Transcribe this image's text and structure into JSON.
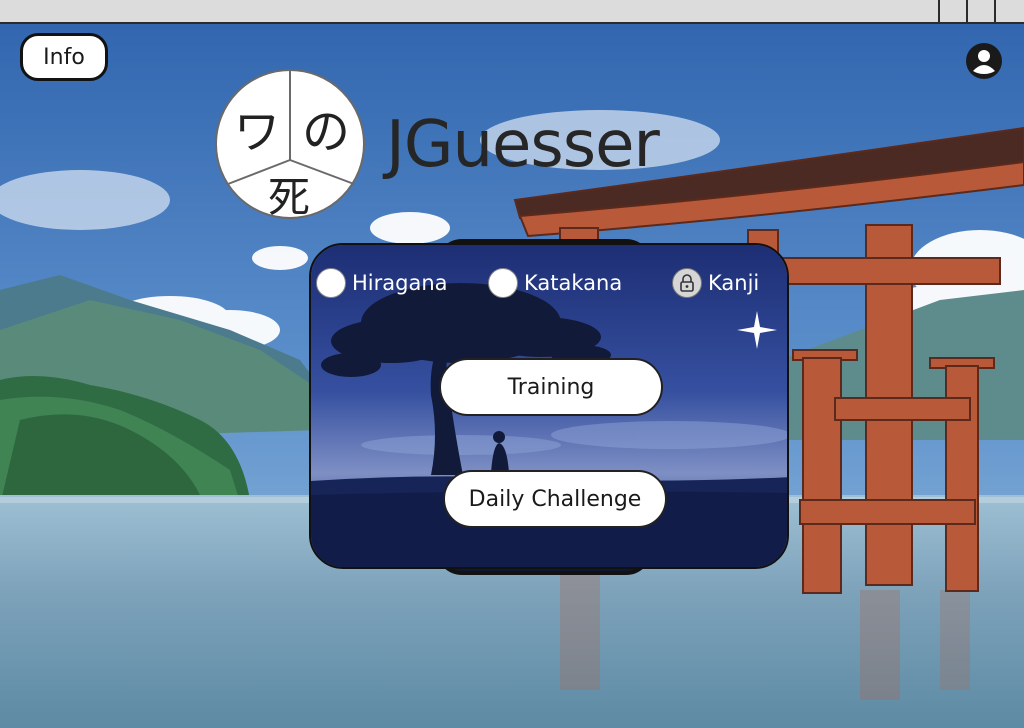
{
  "window": {
    "controls": [
      "",
      "",
      ""
    ]
  },
  "header": {
    "info_label": "Info",
    "account_icon": "user-circle-icon"
  },
  "logo": {
    "chars": [
      "ワ",
      "の",
      "死"
    ],
    "title": "JGuesser"
  },
  "menu": {
    "options": [
      {
        "label": "Hiragana",
        "state": "unchecked"
      },
      {
        "label": "Katakana",
        "state": "unchecked"
      },
      {
        "label": "Kanji",
        "state": "locked",
        "icon": "lock-icon"
      }
    ],
    "buttons": [
      {
        "label": "Training"
      },
      {
        "label": "Daily Challenge"
      }
    ]
  },
  "colors": {
    "sky": "#3f6fb3",
    "water": "#7fa7c0",
    "torii": "#b85a3a",
    "panel_night": "#2a3c84"
  }
}
